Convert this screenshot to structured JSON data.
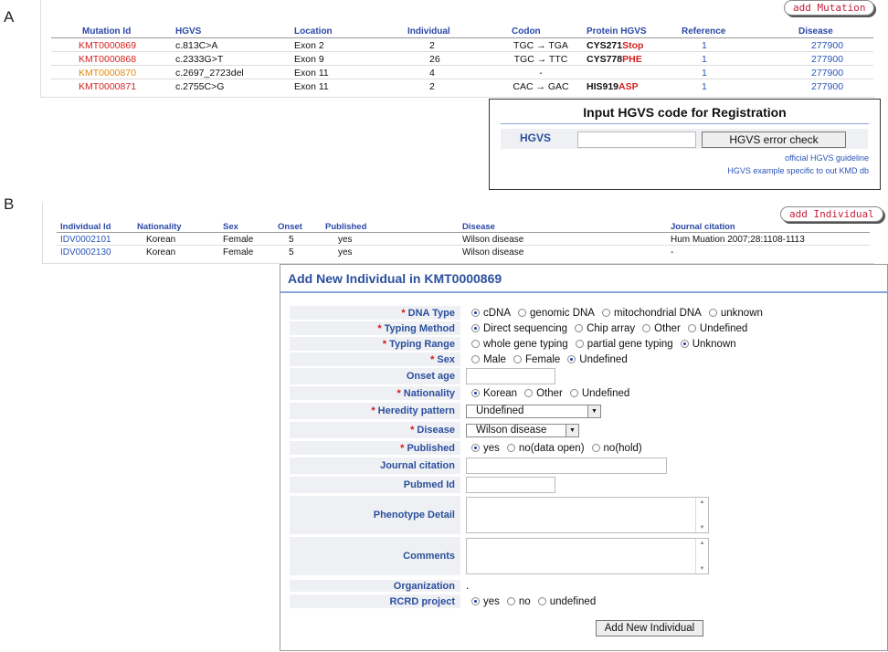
{
  "panels": {
    "a": "A",
    "b": "B"
  },
  "mutations": {
    "add_button": "add Mutation",
    "headers": [
      "Mutation Id",
      "HGVS",
      "Location",
      "Individual",
      "Codon",
      "Protein HGVS",
      "Reference",
      "Disease"
    ],
    "rows": [
      {
        "id": "KMT0000869",
        "id_color": "#d42020",
        "hgvs": "c.813C>A",
        "location": "Exon 2",
        "individual": "2",
        "codon": "TGC → TGA",
        "protein_a": "CYS271",
        "protein_b": "Stop",
        "reference": "1",
        "disease": "277900"
      },
      {
        "id": "KMT0000868",
        "id_color": "#d42020",
        "hgvs": "c.2333G>T",
        "location": "Exon 9",
        "individual": "26",
        "codon": "TGC → TTC",
        "protein_a": "CYS778",
        "protein_b": "PHE",
        "reference": "1",
        "disease": "277900"
      },
      {
        "id": "KMT0000870",
        "id_color": "#e08a10",
        "hgvs": "c.2697_2723del",
        "location": "Exon 11",
        "individual": "4",
        "codon": "-",
        "protein_a": "",
        "protein_b": "",
        "reference": "1",
        "disease": "277900"
      },
      {
        "id": "KMT0000871",
        "id_color": "#d42020",
        "hgvs": "c.2755C>G",
        "location": "Exon 11",
        "individual": "2",
        "codon": "CAC → GAC",
        "protein_a": "HIS919",
        "protein_b": "ASP",
        "reference": "1",
        "disease": "277900"
      }
    ]
  },
  "hgvs_register": {
    "title": "Input HGVS code for Registration",
    "label": "HGVS",
    "input_value": "",
    "check_button": "HGVS error check",
    "guideline_link": "official HGVS guideline",
    "example_link": "HGVS example specific to out KMD db"
  },
  "individuals": {
    "add_button": "add Individual",
    "headers": [
      "Individual Id",
      "Nationality",
      "Sex",
      "Onset",
      "Published",
      "Disease",
      "Journal citation"
    ],
    "rows": [
      {
        "id": "IDV0002101",
        "nationality": "Korean",
        "sex": "Female",
        "onset": "5",
        "published": "yes",
        "disease": "Wilson disease",
        "citation": "Hum Muation 2007;28:1108-1113"
      },
      {
        "id": "IDV0002130",
        "nationality": "Korean",
        "sex": "Female",
        "onset": "5",
        "published": "yes",
        "disease": "Wilson disease",
        "citation": "-"
      }
    ]
  },
  "form": {
    "title": "Add New Individual in KMT0000869",
    "required_mark": "*",
    "dna_type": {
      "label": "DNA Type",
      "options": [
        "cDNA",
        "genomic DNA",
        "mitochondrial DNA",
        "unknown"
      ],
      "selected": 0
    },
    "typing_method": {
      "label": "Typing Method",
      "options": [
        "Direct sequencing",
        "Chip array",
        "Other",
        "Undefined"
      ],
      "selected": 0
    },
    "typing_range": {
      "label": "Typing Range",
      "options": [
        "whole gene typing",
        "partial gene typing",
        "Unknown"
      ],
      "selected": 2
    },
    "sex": {
      "label": "Sex",
      "options": [
        "Male",
        "Female",
        "Undefined"
      ],
      "selected": 2
    },
    "onset_age": {
      "label": "Onset age",
      "value": ""
    },
    "nationality": {
      "label": "Nationality",
      "options": [
        "Korean",
        "Other",
        "Undefined"
      ],
      "selected": 0
    },
    "heredity": {
      "label": "Heredity pattern",
      "value": "Undefined"
    },
    "disease": {
      "label": "Disease",
      "value": "Wilson disease"
    },
    "published": {
      "label": "Published",
      "options": [
        "yes",
        "no(data open)",
        "no(hold)"
      ],
      "selected": 0
    },
    "journal_citation": {
      "label": "Journal citation",
      "value": ""
    },
    "pubmed_id": {
      "label": "Pubmed Id",
      "value": ""
    },
    "phenotype": {
      "label": "Phenotype Detail",
      "value": ""
    },
    "comments": {
      "label": "Comments",
      "value": ""
    },
    "organization": {
      "label": "Organization",
      "value": "."
    },
    "rcrd": {
      "label": "RCRD project",
      "options": [
        "yes",
        "no",
        "undefined"
      ],
      "selected": 0
    },
    "submit_button": "Add New Individual"
  },
  "icons": {
    "scroll_up": "▲",
    "scroll_down": "▼",
    "dropdown": "▼"
  }
}
